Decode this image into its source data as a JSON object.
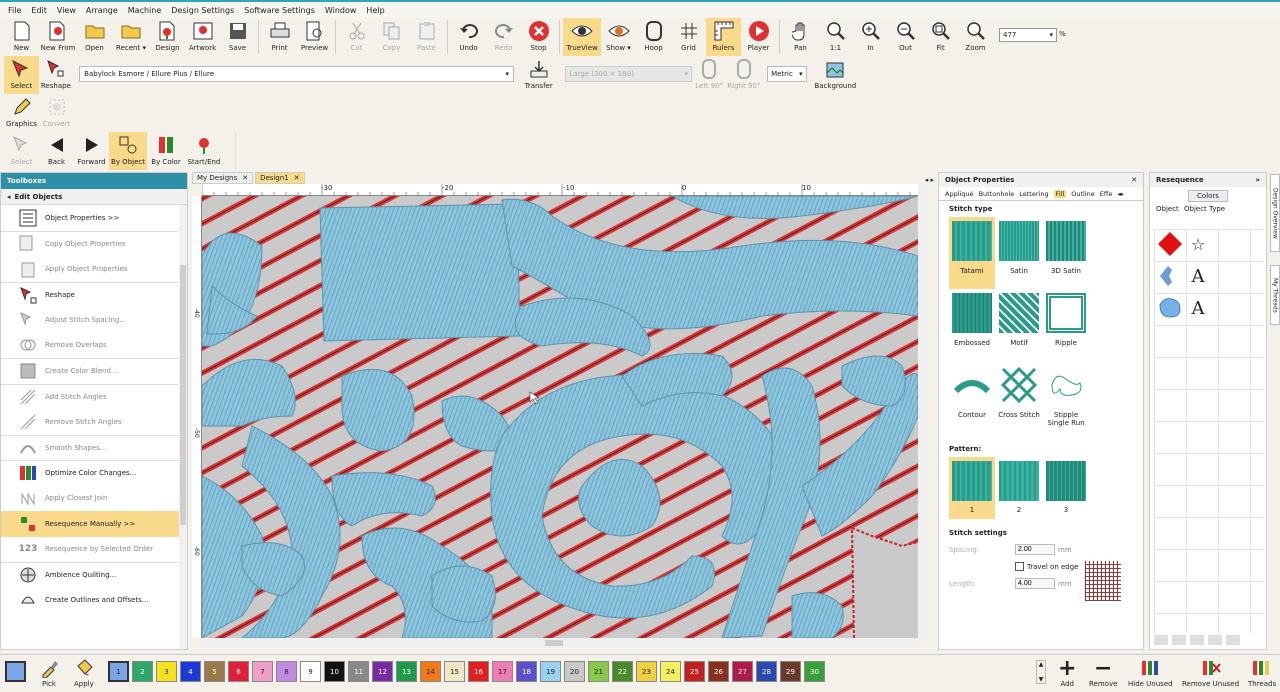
{
  "menu": [
    "File",
    "Edit",
    "View",
    "Arrange",
    "Machine",
    "Design Settings",
    "Software Settings",
    "Window",
    "Help"
  ],
  "toolbar": {
    "new": "New",
    "new_from": "New From",
    "open": "Open",
    "recent": "Recent ▾",
    "design": "Design",
    "artwork": "Artwork",
    "save": "Save",
    "print": "Print",
    "preview": "Preview",
    "cut": "Cut",
    "copy": "Copy",
    "paste": "Paste",
    "undo": "Undo",
    "redo": "Redo",
    "stop": "Stop",
    "trueview": "TrueView",
    "show": "Show ▾",
    "hoop": "Hoop",
    "grid": "Grid",
    "rulers": "Rulers",
    "player": "Player",
    "pan": "Pan",
    "one_to_one": "1:1",
    "zoom_in": "In",
    "zoom_out": "Out",
    "fit": "Fit",
    "zoom": "Zoom",
    "zoom_value": "477",
    "zoom_unit": "%"
  },
  "toolbar2": {
    "select": "Select",
    "reshape": "Reshape",
    "machine": "Babylock Esmore / Ellure Plus / Ellure",
    "transfer": "Transfer",
    "hoop_size": "Large (300 × 180)",
    "left90": "Left 90°",
    "right90": "Right 90°",
    "units": "Metric",
    "background": "Background"
  },
  "toolbar3": {
    "graphics": "Graphics",
    "convert": "Convert"
  },
  "toolbar4": {
    "select": "Select",
    "back": "Back",
    "forward": "Forward",
    "by_object": "By Object",
    "by_color": "By Color",
    "start_end": "Start/End"
  },
  "toolbox": {
    "title": "Toolboxes",
    "section": "Edit Objects",
    "items": [
      "Object Properties >>",
      "Copy Object Properties",
      "Apply Object Properties",
      "Reshape",
      "Adjust Stitch Spacing...",
      "Remove Overlaps",
      "Create Color Blend...",
      "Add Stitch Angles",
      "Remove Stitch Angles",
      "Smooth Shapes...",
      "Optimize Color Changes...",
      "Apply Closest Join",
      "Resequence Manually >>",
      "Resequence by Selected Order",
      "Ambience Quilting...",
      "Create Outlines and Offsets..."
    ]
  },
  "doc_tabs": [
    "My Designs",
    "Design1"
  ],
  "ruler": {
    "h": [
      "-30",
      "-20",
      "-10",
      "0",
      "10"
    ],
    "v": [
      "-40",
      "-50",
      "-60"
    ]
  },
  "props": {
    "title": "Object Properties",
    "tabs": [
      "Appliqué",
      "Buttonhole",
      "Lettering",
      "Fill",
      "Outline",
      "Effe"
    ],
    "stitch_type_label": "Stitch type",
    "stitch_types": [
      "Tatami",
      "Satin",
      "3D Satin",
      "Embossed",
      "Motif",
      "Ripple",
      "Contour",
      "Cross Stitch",
      "Stipple Single Run"
    ],
    "pattern_label": "Pattern:",
    "patterns": [
      "1",
      "2",
      "3"
    ],
    "settings_label": "Stitch settings",
    "spacing_label": "Spacing:",
    "spacing": "2.00",
    "travel": "Travel on edge",
    "length_label": "Length:",
    "length": "4.00",
    "unit": "mm"
  },
  "reseq": {
    "title": "Resequence",
    "colors_btn": "Colors",
    "col_object": "Object",
    "col_type": "Object Type",
    "letter": "A"
  },
  "side_tabs": {
    "overview": "Design Overview",
    "threads": "My Threads"
  },
  "palette": [
    "1",
    "2",
    "3",
    "4",
    "5",
    "6",
    "7",
    "8",
    "9",
    "10",
    "11",
    "12",
    "13",
    "14",
    "15",
    "16",
    "17",
    "18",
    "19",
    "20",
    "21",
    "22",
    "23",
    "24",
    "25",
    "26",
    "27",
    "28",
    "29",
    "30"
  ],
  "palette_colors": [
    "#7aa6e6",
    "#2ea86a",
    "#f5e21a",
    "#1a3ad6",
    "#9a7a4a",
    "#e0203a",
    "#f0a0c8",
    "#c08ae0",
    "#ffffff",
    "#111111",
    "#888888",
    "#7a2aa0",
    "#1f9a4a",
    "#f07a1a",
    "#f2e8c8",
    "#e02020",
    "#f07ab4",
    "#5a50c8",
    "#9ad0f0",
    "#c8c8c8",
    "#8ac84a",
    "#4a8a2a",
    "#f0d040",
    "#f5f060",
    "#c02020",
    "#8a3020",
    "#b01a4a",
    "#2a4ab0",
    "#6a3a2a",
    "#3aa03a"
  ],
  "bottom": {
    "pick": "Pick",
    "apply": "Apply",
    "add": "Add",
    "remove": "Remove",
    "hide_unused": "Hide Unused",
    "remove_unused": "Remove Unused",
    "threads": "Threads"
  },
  "colors": {
    "accent": "#2e8fa8",
    "highlight": "#f9d98a",
    "thread": "#8cc6df",
    "fabric": "#cacaca",
    "stripe": "#d8383a"
  }
}
